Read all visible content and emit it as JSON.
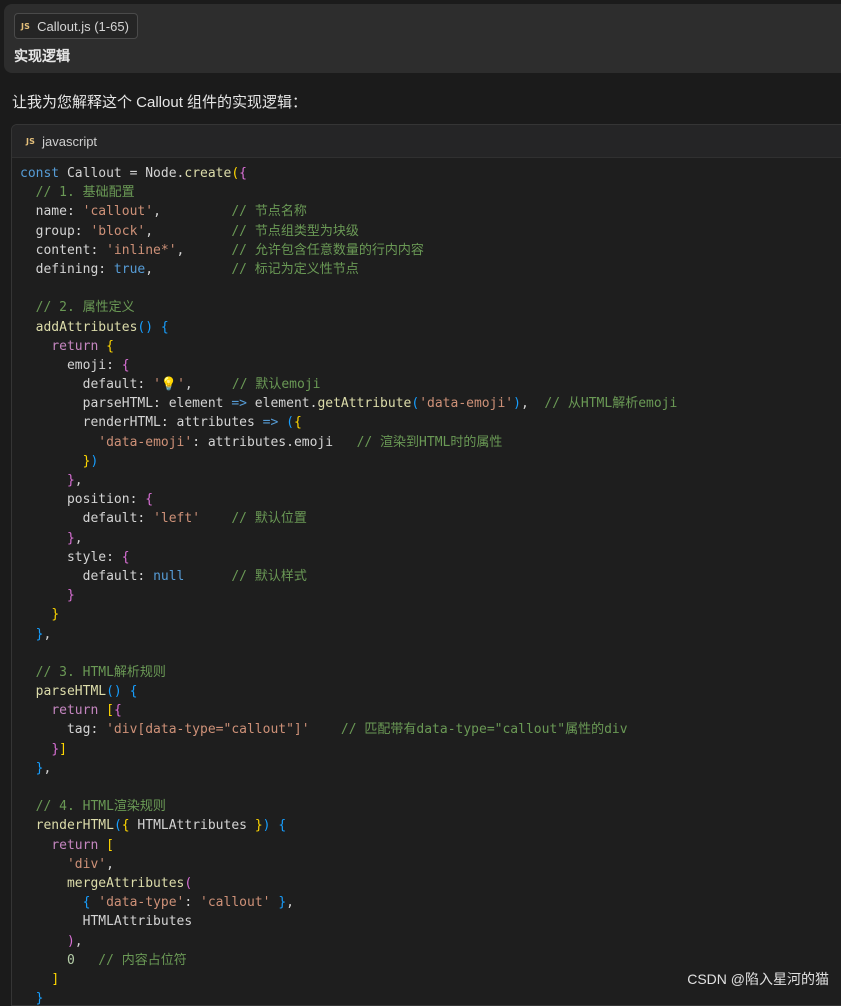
{
  "user_message": {
    "file_chip": {
      "icon": "JS",
      "name": "Callout.js (1-65)"
    },
    "text": "实现逻辑"
  },
  "assistant": {
    "intro": "让我为您解释这个 Callout 组件的实现逻辑：",
    "code_block": {
      "language_icon": "JS",
      "language": "javascript",
      "lines": [
        [
          [
            "const",
            "kw"
          ],
          [
            " Callout = Node.",
            "p"
          ],
          [
            "create",
            "fn"
          ],
          [
            "(",
            "b1"
          ],
          [
            "{",
            "b2"
          ]
        ],
        [
          [
            "  // 1. 基础配置",
            "com"
          ]
        ],
        [
          [
            "  name: ",
            "p"
          ],
          [
            "'callout'",
            "str"
          ],
          [
            ",         ",
            "p"
          ],
          [
            "// 节点名称",
            "com"
          ]
        ],
        [
          [
            "  group: ",
            "p"
          ],
          [
            "'block'",
            "str"
          ],
          [
            ",          ",
            "p"
          ],
          [
            "// 节点组类型为块级",
            "com"
          ]
        ],
        [
          [
            "  content: ",
            "p"
          ],
          [
            "'inline*'",
            "str"
          ],
          [
            ",      ",
            "p"
          ],
          [
            "// 允许包含任意数量的行内内容",
            "com"
          ]
        ],
        [
          [
            "  defining: ",
            "p"
          ],
          [
            "true",
            "kw"
          ],
          [
            ",          ",
            "p"
          ],
          [
            "// 标记为定义性节点",
            "com"
          ]
        ],
        [
          [
            "",
            "p"
          ]
        ],
        [
          [
            "  // 2. 属性定义",
            "com"
          ]
        ],
        [
          [
            "  ",
            "p"
          ],
          [
            "addAttributes",
            "fn"
          ],
          [
            "()",
            "b3"
          ],
          [
            " ",
            "p"
          ],
          [
            "{",
            "b3"
          ]
        ],
        [
          [
            "    ",
            "p"
          ],
          [
            "return",
            "ctl"
          ],
          [
            " ",
            "p"
          ],
          [
            "{",
            "b1"
          ]
        ],
        [
          [
            "      emoji: ",
            "p"
          ],
          [
            "{",
            "b2"
          ]
        ],
        [
          [
            "        default: ",
            "p"
          ],
          [
            "'💡'",
            "str"
          ],
          [
            ",     ",
            "p"
          ],
          [
            "// 默认emoji",
            "com"
          ]
        ],
        [
          [
            "        parseHTML: element ",
            "p"
          ],
          [
            "=>",
            "kw"
          ],
          [
            " element.",
            "p"
          ],
          [
            "getAttribute",
            "fn"
          ],
          [
            "(",
            "b3"
          ],
          [
            "'data-emoji'",
            "str"
          ],
          [
            ")",
            "b3"
          ],
          [
            ",  ",
            "p"
          ],
          [
            "// 从HTML解析emoji",
            "com"
          ]
        ],
        [
          [
            "        renderHTML: attributes ",
            "p"
          ],
          [
            "=>",
            "kw"
          ],
          [
            " ",
            "p"
          ],
          [
            "(",
            "b3"
          ],
          [
            "{",
            "b1"
          ]
        ],
        [
          [
            "          ",
            "p"
          ],
          [
            "'data-emoji'",
            "str"
          ],
          [
            ": attributes.emoji   ",
            "p"
          ],
          [
            "// 渲染到HTML时的属性",
            "com"
          ]
        ],
        [
          [
            "        ",
            "p"
          ],
          [
            "}",
            "b1"
          ],
          [
            ")",
            "b3"
          ]
        ],
        [
          [
            "      ",
            "p"
          ],
          [
            "}",
            "b2"
          ],
          [
            ",",
            "p"
          ]
        ],
        [
          [
            "      position: ",
            "p"
          ],
          [
            "{",
            "b2"
          ]
        ],
        [
          [
            "        default: ",
            "p"
          ],
          [
            "'left'",
            "str"
          ],
          [
            "    ",
            "p"
          ],
          [
            "// 默认位置",
            "com"
          ]
        ],
        [
          [
            "      ",
            "p"
          ],
          [
            "}",
            "b2"
          ],
          [
            ",",
            "p"
          ]
        ],
        [
          [
            "      style: ",
            "p"
          ],
          [
            "{",
            "b2"
          ]
        ],
        [
          [
            "        default: ",
            "p"
          ],
          [
            "null",
            "kw"
          ],
          [
            "      ",
            "p"
          ],
          [
            "// 默认样式",
            "com"
          ]
        ],
        [
          [
            "      ",
            "p"
          ],
          [
            "}",
            "b2"
          ]
        ],
        [
          [
            "    ",
            "p"
          ],
          [
            "}",
            "b1"
          ]
        ],
        [
          [
            "  ",
            "p"
          ],
          [
            "}",
            "b3"
          ],
          [
            ",",
            "p"
          ]
        ],
        [
          [
            "",
            "p"
          ]
        ],
        [
          [
            "  // 3. HTML解析规则",
            "com"
          ]
        ],
        [
          [
            "  ",
            "p"
          ],
          [
            "parseHTML",
            "fn"
          ],
          [
            "()",
            "b3"
          ],
          [
            " ",
            "p"
          ],
          [
            "{",
            "b3"
          ]
        ],
        [
          [
            "    ",
            "p"
          ],
          [
            "return",
            "ctl"
          ],
          [
            " ",
            "p"
          ],
          [
            "[",
            "b1"
          ],
          [
            "{",
            "b2"
          ]
        ],
        [
          [
            "      tag: ",
            "p"
          ],
          [
            "'div[data-type=\"callout\"]'",
            "str"
          ],
          [
            "    ",
            "p"
          ],
          [
            "// 匹配带有data-type=\"callout\"属性的div",
            "com"
          ]
        ],
        [
          [
            "    ",
            "p"
          ],
          [
            "}",
            "b2"
          ],
          [
            "]",
            "b1"
          ]
        ],
        [
          [
            "  ",
            "p"
          ],
          [
            "}",
            "b3"
          ],
          [
            ",",
            "p"
          ]
        ],
        [
          [
            "",
            "p"
          ]
        ],
        [
          [
            "  // 4. HTML渲染规则",
            "com"
          ]
        ],
        [
          [
            "  ",
            "p"
          ],
          [
            "renderHTML",
            "fn"
          ],
          [
            "(",
            "b3"
          ],
          [
            "{",
            "b1"
          ],
          [
            " HTMLAttributes ",
            "p"
          ],
          [
            "}",
            "b1"
          ],
          [
            ")",
            "b3"
          ],
          [
            " ",
            "p"
          ],
          [
            "{",
            "b3"
          ]
        ],
        [
          [
            "    ",
            "p"
          ],
          [
            "return",
            "ctl"
          ],
          [
            " ",
            "p"
          ],
          [
            "[",
            "b1"
          ]
        ],
        [
          [
            "      ",
            "p"
          ],
          [
            "'div'",
            "str"
          ],
          [
            ",",
            "p"
          ]
        ],
        [
          [
            "      ",
            "p"
          ],
          [
            "mergeAttributes",
            "fn"
          ],
          [
            "(",
            "b2"
          ]
        ],
        [
          [
            "        ",
            "p"
          ],
          [
            "{",
            "b3"
          ],
          [
            " ",
            "p"
          ],
          [
            "'data-type'",
            "str"
          ],
          [
            ": ",
            "p"
          ],
          [
            "'callout'",
            "str"
          ],
          [
            " ",
            "p"
          ],
          [
            "}",
            "b3"
          ],
          [
            ",",
            "p"
          ]
        ],
        [
          [
            "        HTMLAttributes",
            "p"
          ]
        ],
        [
          [
            "      ",
            "p"
          ],
          [
            ")",
            "b2"
          ],
          [
            ",",
            "p"
          ]
        ],
        [
          [
            "      ",
            "p"
          ],
          [
            "0",
            "num"
          ],
          [
            "   ",
            "p"
          ],
          [
            "// 内容占位符",
            "com"
          ]
        ],
        [
          [
            "    ",
            "p"
          ],
          [
            "]",
            "b1"
          ]
        ],
        [
          [
            "  ",
            "p"
          ],
          [
            "}",
            "b3"
          ]
        ]
      ]
    }
  },
  "watermark": "CSDN @陷入星河的猫"
}
